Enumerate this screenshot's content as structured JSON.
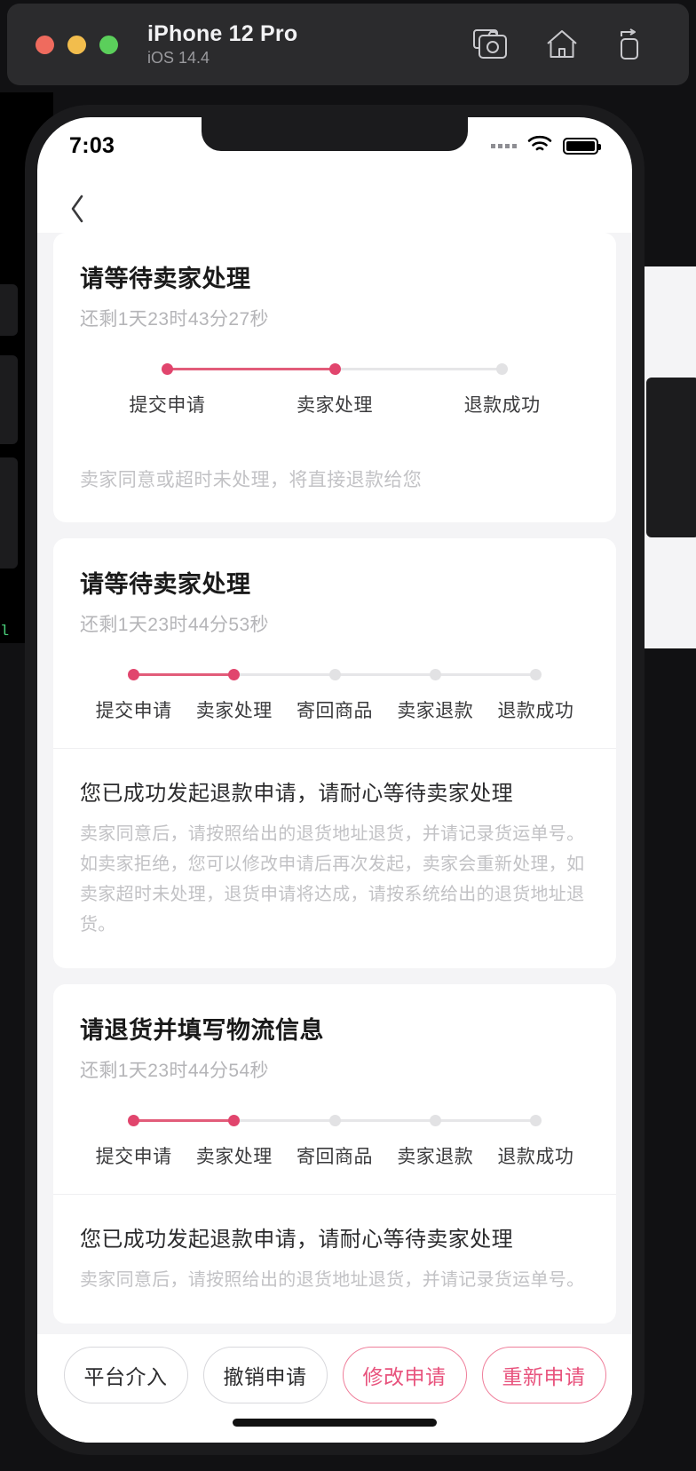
{
  "simulator": {
    "device_name": "iPhone 12 Pro",
    "os_version": "iOS 14.4",
    "actions": [
      {
        "name": "screenshot-icon",
        "label": "Screenshot"
      },
      {
        "name": "home-icon",
        "label": "Home"
      },
      {
        "name": "rotate-icon",
        "label": "Rotate"
      }
    ]
  },
  "status_bar": {
    "time": "7:03",
    "signal_icon": "signal-dots-icon",
    "wifi_icon": "wifi-icon",
    "battery_icon": "battery-icon"
  },
  "nav": {
    "back_icon": "chevron-left-icon"
  },
  "cards": [
    {
      "title": "请等待卖家处理",
      "countdown": "还剩1天23时43分27秒",
      "steps": [
        {
          "label": "提交申请",
          "done": true
        },
        {
          "label": "卖家处理",
          "done": true
        },
        {
          "label": "退款成功",
          "done": false
        }
      ],
      "note": "卖家同意或超时未处理，将直接退款给您"
    },
    {
      "title": "请等待卖家处理",
      "countdown": "还剩1天23时44分53秒",
      "steps": [
        {
          "label": "提交申请",
          "done": true
        },
        {
          "label": "卖家处理",
          "done": true
        },
        {
          "label": "寄回商品",
          "done": false
        },
        {
          "label": "卖家退款",
          "done": false
        },
        {
          "label": "退款成功",
          "done": false
        }
      ],
      "section_title": "您已成功发起退款申请，请耐心等待卖家处理",
      "section_body": "卖家同意后，请按照给出的退货地址退货，并请记录货运单号。如卖家拒绝，您可以修改申请后再次发起，卖家会重新处理，如卖家超时未处理，退货申请将达成，请按系统给出的退货地址退货。"
    },
    {
      "title": "请退货并填写物流信息",
      "countdown": "还剩1天23时44分54秒",
      "steps": [
        {
          "label": "提交申请",
          "done": true
        },
        {
          "label": "卖家处理",
          "done": true
        },
        {
          "label": "寄回商品",
          "done": false
        },
        {
          "label": "卖家退款",
          "done": false
        },
        {
          "label": "退款成功",
          "done": false
        }
      ],
      "section_title": "您已成功发起退款申请，请耐心等待卖家处理",
      "section_body": "卖家同意后，请按照给出的退货地址退货，并请记录货运单号。"
    }
  ],
  "bottom_bar": {
    "buttons": [
      {
        "label": "平台介入",
        "accent": false
      },
      {
        "label": "撤销申请",
        "accent": false
      },
      {
        "label": "修改申请",
        "accent": true
      },
      {
        "label": "重新申请",
        "accent": true
      }
    ]
  },
  "colors": {
    "accent": "#e1456d",
    "accent_border": "#ef7f9b",
    "accent_text": "#e8537d",
    "step_inactive": "#e2e2e4",
    "page_bg": "#f4f4f6"
  }
}
